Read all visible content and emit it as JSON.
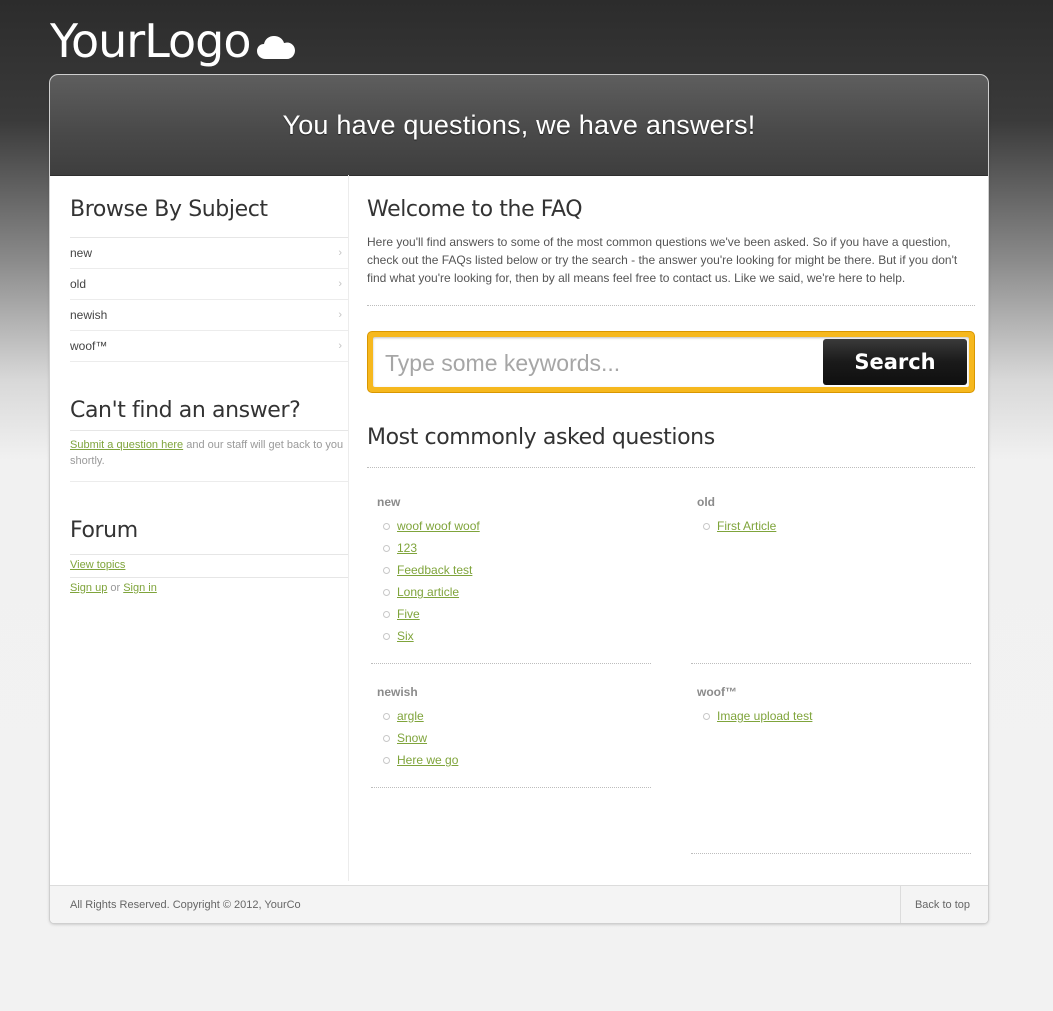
{
  "logo": {
    "text": "YourLogo",
    "icon": "cloud-icon"
  },
  "banner": {
    "headline": "You have questions, we have answers!"
  },
  "sidebar": {
    "browse_heading": "Browse By Subject",
    "subjects": [
      {
        "label": "new"
      },
      {
        "label": "old"
      },
      {
        "label": "newish"
      },
      {
        "label": "woof™"
      }
    ],
    "cant_find_heading": "Can't find an answer?",
    "submit_link": "Submit a question here",
    "submit_suffix": "and our staff will get back to you shortly.",
    "forum_heading": "Forum",
    "view_topics": "View topics",
    "sign_up": "Sign up",
    "or_text": "or",
    "sign_in": "Sign in"
  },
  "main": {
    "welcome_heading": "Welcome to the FAQ",
    "intro": "Here you'll find answers to some of the most common questions we've been asked. So if you have a question, check out the FAQs listed below or try the search - the answer you're looking for might be there. But if you don't find what you're looking for, then by all means feel free to contact us. Like we said, we're here to help.",
    "search": {
      "placeholder": "Type some keywords...",
      "button": "Search"
    },
    "common_heading": "Most commonly asked questions",
    "categories": [
      {
        "title": "new",
        "items": [
          "woof woof woof",
          "123",
          "Feedback test",
          "Long article",
          "Five",
          "Six"
        ]
      },
      {
        "title": "old",
        "items": [
          "First Article"
        ]
      },
      {
        "title": "newish",
        "items": [
          "argle",
          "Snow",
          "Here we go"
        ]
      },
      {
        "title": "woof™",
        "items": [
          "Image upload test"
        ]
      }
    ]
  },
  "footer": {
    "copyright": "All Rights Reserved. Copyright © 2012, YourCo",
    "back_to_top": "Back to top"
  },
  "colors": {
    "link": "#7fa43b",
    "search_border": "#f6b81e",
    "banner": "#4a4a4a"
  }
}
